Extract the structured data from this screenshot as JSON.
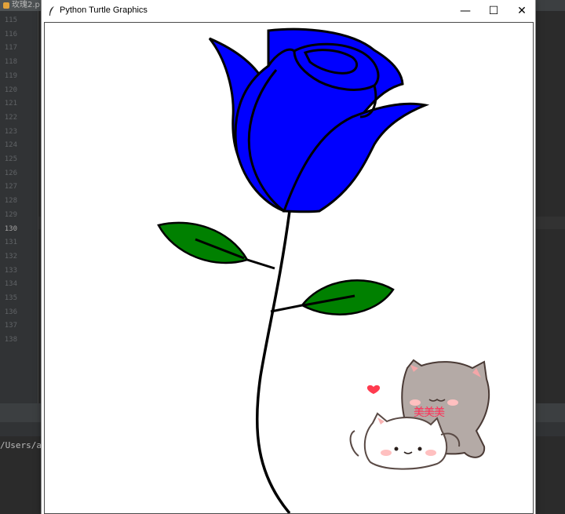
{
  "ide": {
    "tab_label": "玫瑰2.p",
    "line_numbers": [
      "115",
      "116",
      "117",
      "118",
      "119",
      "120",
      "121",
      "122",
      "123",
      "124",
      "125",
      "126",
      "127",
      "128",
      "129",
      "130",
      "131",
      "132",
      "133",
      "134",
      "135",
      "136",
      "137",
      "138"
    ],
    "current_line": "130",
    "terminal_text": "/Users/ac"
  },
  "window": {
    "title": "Python Turtle Graphics",
    "minimize_glyph": "—",
    "maximize_glyph": "☐",
    "close_glyph": "✕"
  },
  "drawing": {
    "rose_color": "#0000ff",
    "leaf_color": "#008000",
    "outline_color": "#000000",
    "sticker_text": "美美美",
    "sticker_text_color": "#ff2d55",
    "icons": [
      "turtle-feather-icon",
      "heart-icon",
      "grey-cat-icon",
      "white-cat-icon"
    ]
  }
}
